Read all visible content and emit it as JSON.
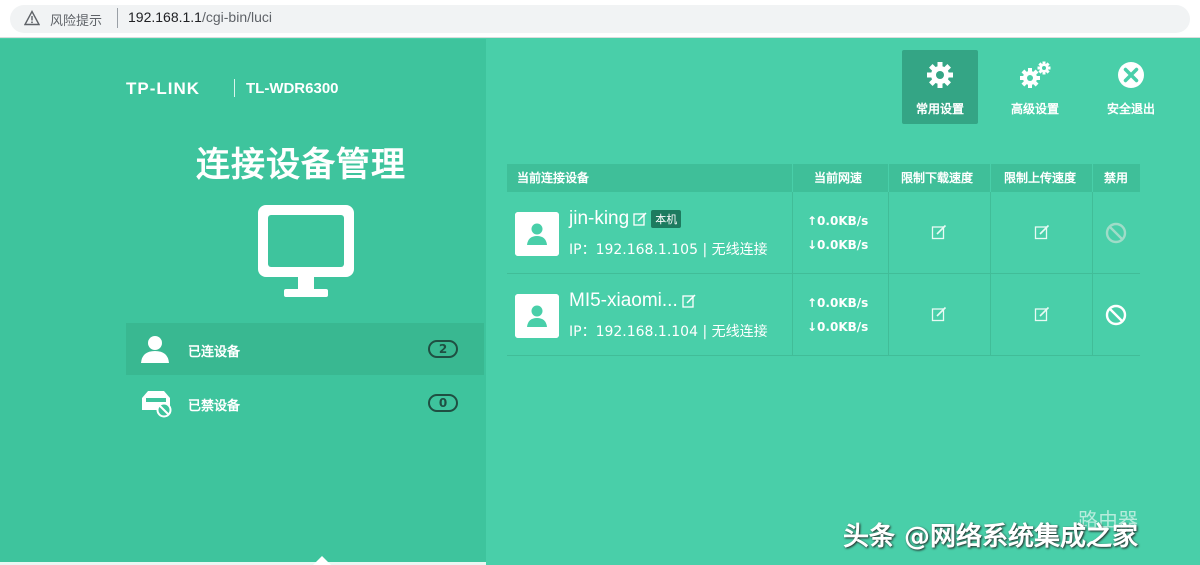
{
  "browser": {
    "warning": "风险提示",
    "url_host": "192.168.1.1",
    "url_path": "/cgi-bin/luci"
  },
  "brand": {
    "logo": "TP-LINK",
    "model": "TL-WDR6300"
  },
  "page_title": "连接设备管理",
  "nav": [
    {
      "label": "已连设备",
      "count": "2",
      "icon": "user-icon"
    },
    {
      "label": "已禁设备",
      "count": "0",
      "icon": "blocked-device-icon"
    }
  ],
  "top_buttons": [
    {
      "label": "常用设置",
      "icon": "gear-icon"
    },
    {
      "label": "高级设置",
      "icon": "gears-icon"
    },
    {
      "label": "安全退出",
      "icon": "close-circle-icon"
    }
  ],
  "table": {
    "headers": [
      "当前连接设备",
      "当前网速",
      "限制下载速度",
      "限制上传速度",
      "禁用"
    ],
    "rows": [
      {
        "name": "jin-king",
        "badge": "本机",
        "ip": "IP：192.168.1.105 | 无线连接",
        "up": "↑0.0KB/s",
        "down": "↓0.0KB/s"
      },
      {
        "name": "MI5-xiaomi...",
        "badge": "",
        "ip": "IP：192.168.1.104 | 无线连接",
        "up": "↑0.0KB/s",
        "down": "↓0.0KB/s"
      }
    ]
  },
  "watermark": {
    "text": "头条 @网络系统集成之家",
    "router": "路由器"
  },
  "colors": {
    "bg": "#49cfa9",
    "panel": "#3ec49d",
    "active": "#34a585"
  }
}
